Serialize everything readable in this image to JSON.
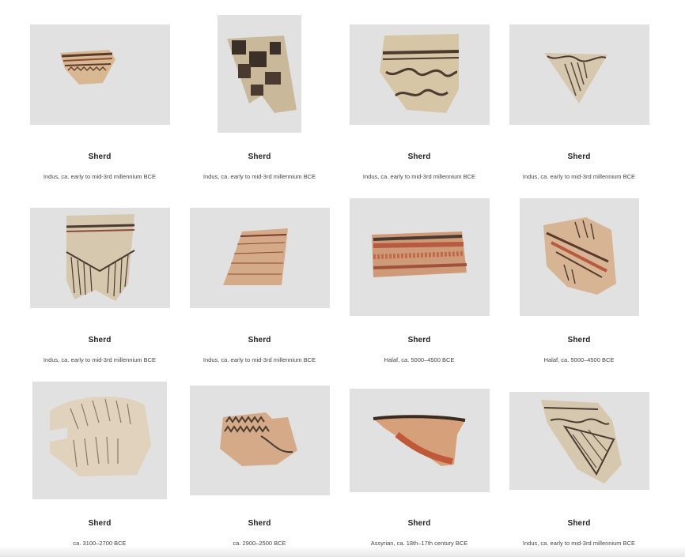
{
  "results": [
    {
      "title": "Sherd",
      "meta": "Indus, ca. early to mid-3rd millennium BCE"
    },
    {
      "title": "Sherd",
      "meta": "Indus, ca. early to mid-3rd millennium BCE"
    },
    {
      "title": "Sherd",
      "meta": "Indus, ca. early to mid-3rd millennium BCE"
    },
    {
      "title": "Sherd",
      "meta": "Indus, ca. early to mid-3rd millennium BCE"
    },
    {
      "title": "Sherd",
      "meta": "Indus, ca. early to mid-3rd millennium BCE"
    },
    {
      "title": "Sherd",
      "meta": "Indus, ca. early to mid-3rd millennium BCE"
    },
    {
      "title": "Sherd",
      "meta": "Halaf, ca. 5000–4500 BCE"
    },
    {
      "title": "Sherd",
      "meta": "Halaf, ca. 5000–4500 BCE"
    },
    {
      "title": "Sherd",
      "meta": "ca. 3100–2700 BCE"
    },
    {
      "title": "Sherd",
      "meta": "ca. 2900–2500 BCE"
    },
    {
      "title": "Sherd",
      "meta": "Assyrian, ca. 18th–17th century BCE"
    },
    {
      "title": "Sherd",
      "meta": "Indus, ca. early to mid-3rd millennium BCE"
    }
  ],
  "colors": {
    "thumb_bg": "#e1e1e1",
    "title": "#222222",
    "meta": "#444444"
  }
}
